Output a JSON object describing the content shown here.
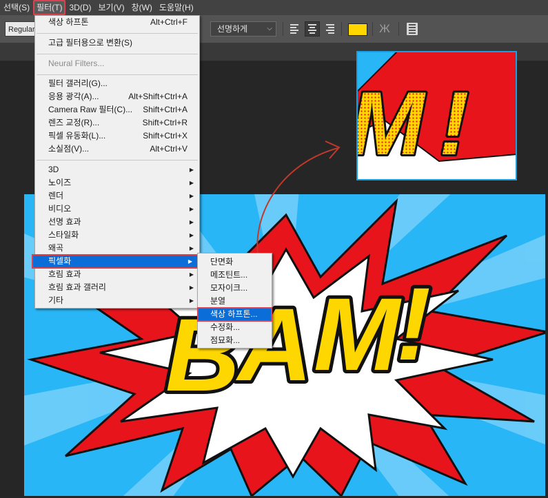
{
  "menubar": {
    "items": [
      "선택(S)",
      "필터(T)",
      "3D(D)",
      "보기(V)",
      "창(W)",
      "도움말(H)"
    ],
    "active_index": 1
  },
  "options": {
    "font_style": "Regular",
    "antialias": "선명하게",
    "text_color": "#ffd700"
  },
  "filter_menu": {
    "last_filter": {
      "label": "색상 하프톤",
      "shortcut": "Alt+Ctrl+F"
    },
    "smart": {
      "label": "고급 필터용으로 변환(S)"
    },
    "neural": {
      "label": "Neural Filters..."
    },
    "gallery": [
      {
        "label": "필터 갤러리(G)...",
        "shortcut": ""
      },
      {
        "label": "응용 광각(A)...",
        "shortcut": "Alt+Shift+Ctrl+A"
      },
      {
        "label": "Camera Raw 필터(C)...",
        "shortcut": "Shift+Ctrl+A"
      },
      {
        "label": "렌즈 교정(R)...",
        "shortcut": "Shift+Ctrl+R"
      },
      {
        "label": "픽셀 유동화(L)...",
        "shortcut": "Shift+Ctrl+X"
      },
      {
        "label": "소실점(V)...",
        "shortcut": "Alt+Ctrl+V"
      }
    ],
    "groups": [
      "3D",
      "노이즈",
      "렌더",
      "비디오",
      "선명 효과",
      "스타일화",
      "왜곡",
      "픽셀화",
      "흐림 효과",
      "흐림 효과 갤러리",
      "기타"
    ],
    "highlighted_group": "픽셀화"
  },
  "pixelate_submenu": {
    "items": [
      "단면화",
      "메조틴트...",
      "모자이크...",
      "분열",
      "색상 하프톤...",
      "수정화...",
      "점묘화..."
    ],
    "highlighted": "색상 하프톤..."
  },
  "artwork": {
    "text": "BAM!",
    "colors": {
      "sky": "#29b6f6",
      "ray": "#7fd3fa",
      "red": "#e8141b",
      "yellow": "#ffd700",
      "ink": "#111111"
    }
  },
  "icons": [
    "align-left-icon",
    "align-center-icon",
    "align-right-icon",
    "warp-text-icon",
    "character-panel-icon",
    "submenu-arrow-icon",
    "curved-arrow-icon"
  ]
}
